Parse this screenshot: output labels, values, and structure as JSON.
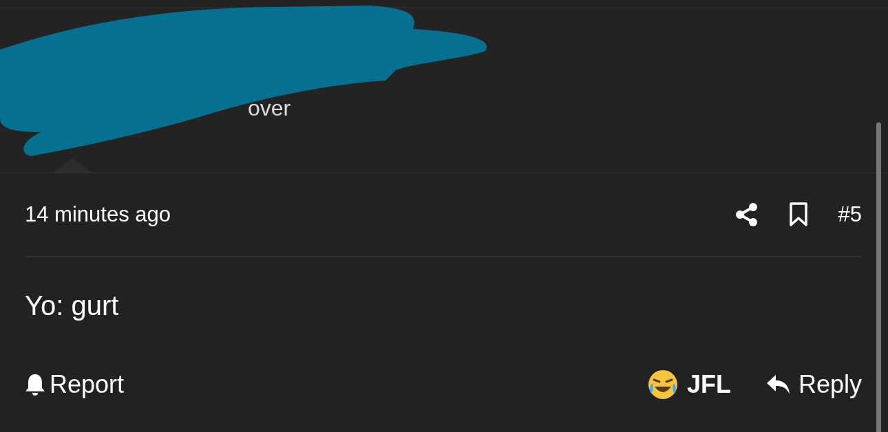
{
  "header": {
    "visible_text": "over"
  },
  "post": {
    "time": "14 minutes ago",
    "number": "#5",
    "body": "Yo: gurt"
  },
  "actions": [
    {
      "kind": "report",
      "label": "Report"
    },
    {
      "kind": "reaction",
      "label": "JFL"
    },
    {
      "kind": "reply",
      "label": "Reply"
    }
  ]
}
